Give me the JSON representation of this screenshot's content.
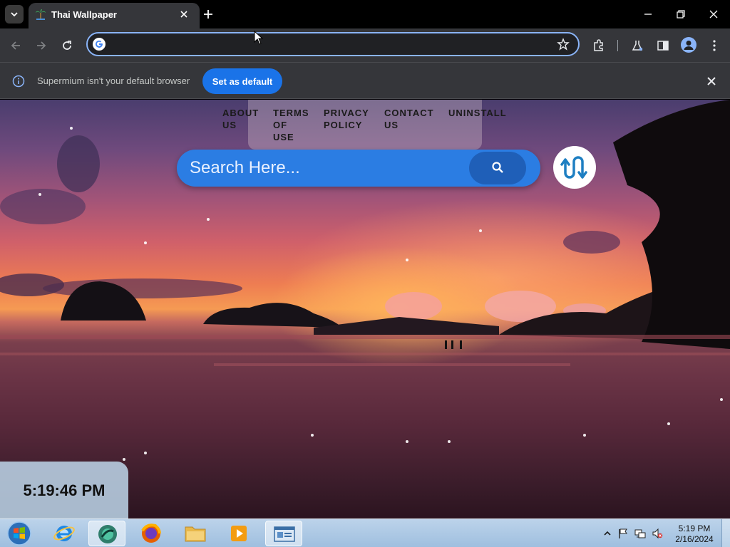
{
  "browser": {
    "tab_title": "Thai Wallpaper",
    "address_value": "",
    "infobar_message": "Supermium isn't your default browser",
    "set_default_label": "Set as default"
  },
  "page": {
    "nav": [
      {
        "label_line1": "ABOUT",
        "label_line2": "US",
        "label_line3": ""
      },
      {
        "label_line1": "TERMS",
        "label_line2": "OF",
        "label_line3": "USE"
      },
      {
        "label_line1": "PRIVACY",
        "label_line2": "POLICY",
        "label_line3": ""
      },
      {
        "label_line1": "CONTACT",
        "label_line2": "US",
        "label_line3": ""
      },
      {
        "label_line1": "UNINSTALL",
        "label_line2": "",
        "label_line3": ""
      }
    ],
    "search_placeholder": "Search Here...",
    "clock_time": "5:19:46 PM"
  },
  "taskbar": {
    "tray_time": "5:19 PM",
    "tray_date": "2/16/2024"
  },
  "colors": {
    "accent": "#1a73e8",
    "search_bar": "#2b7de3",
    "search_button": "#1f5fb8"
  }
}
